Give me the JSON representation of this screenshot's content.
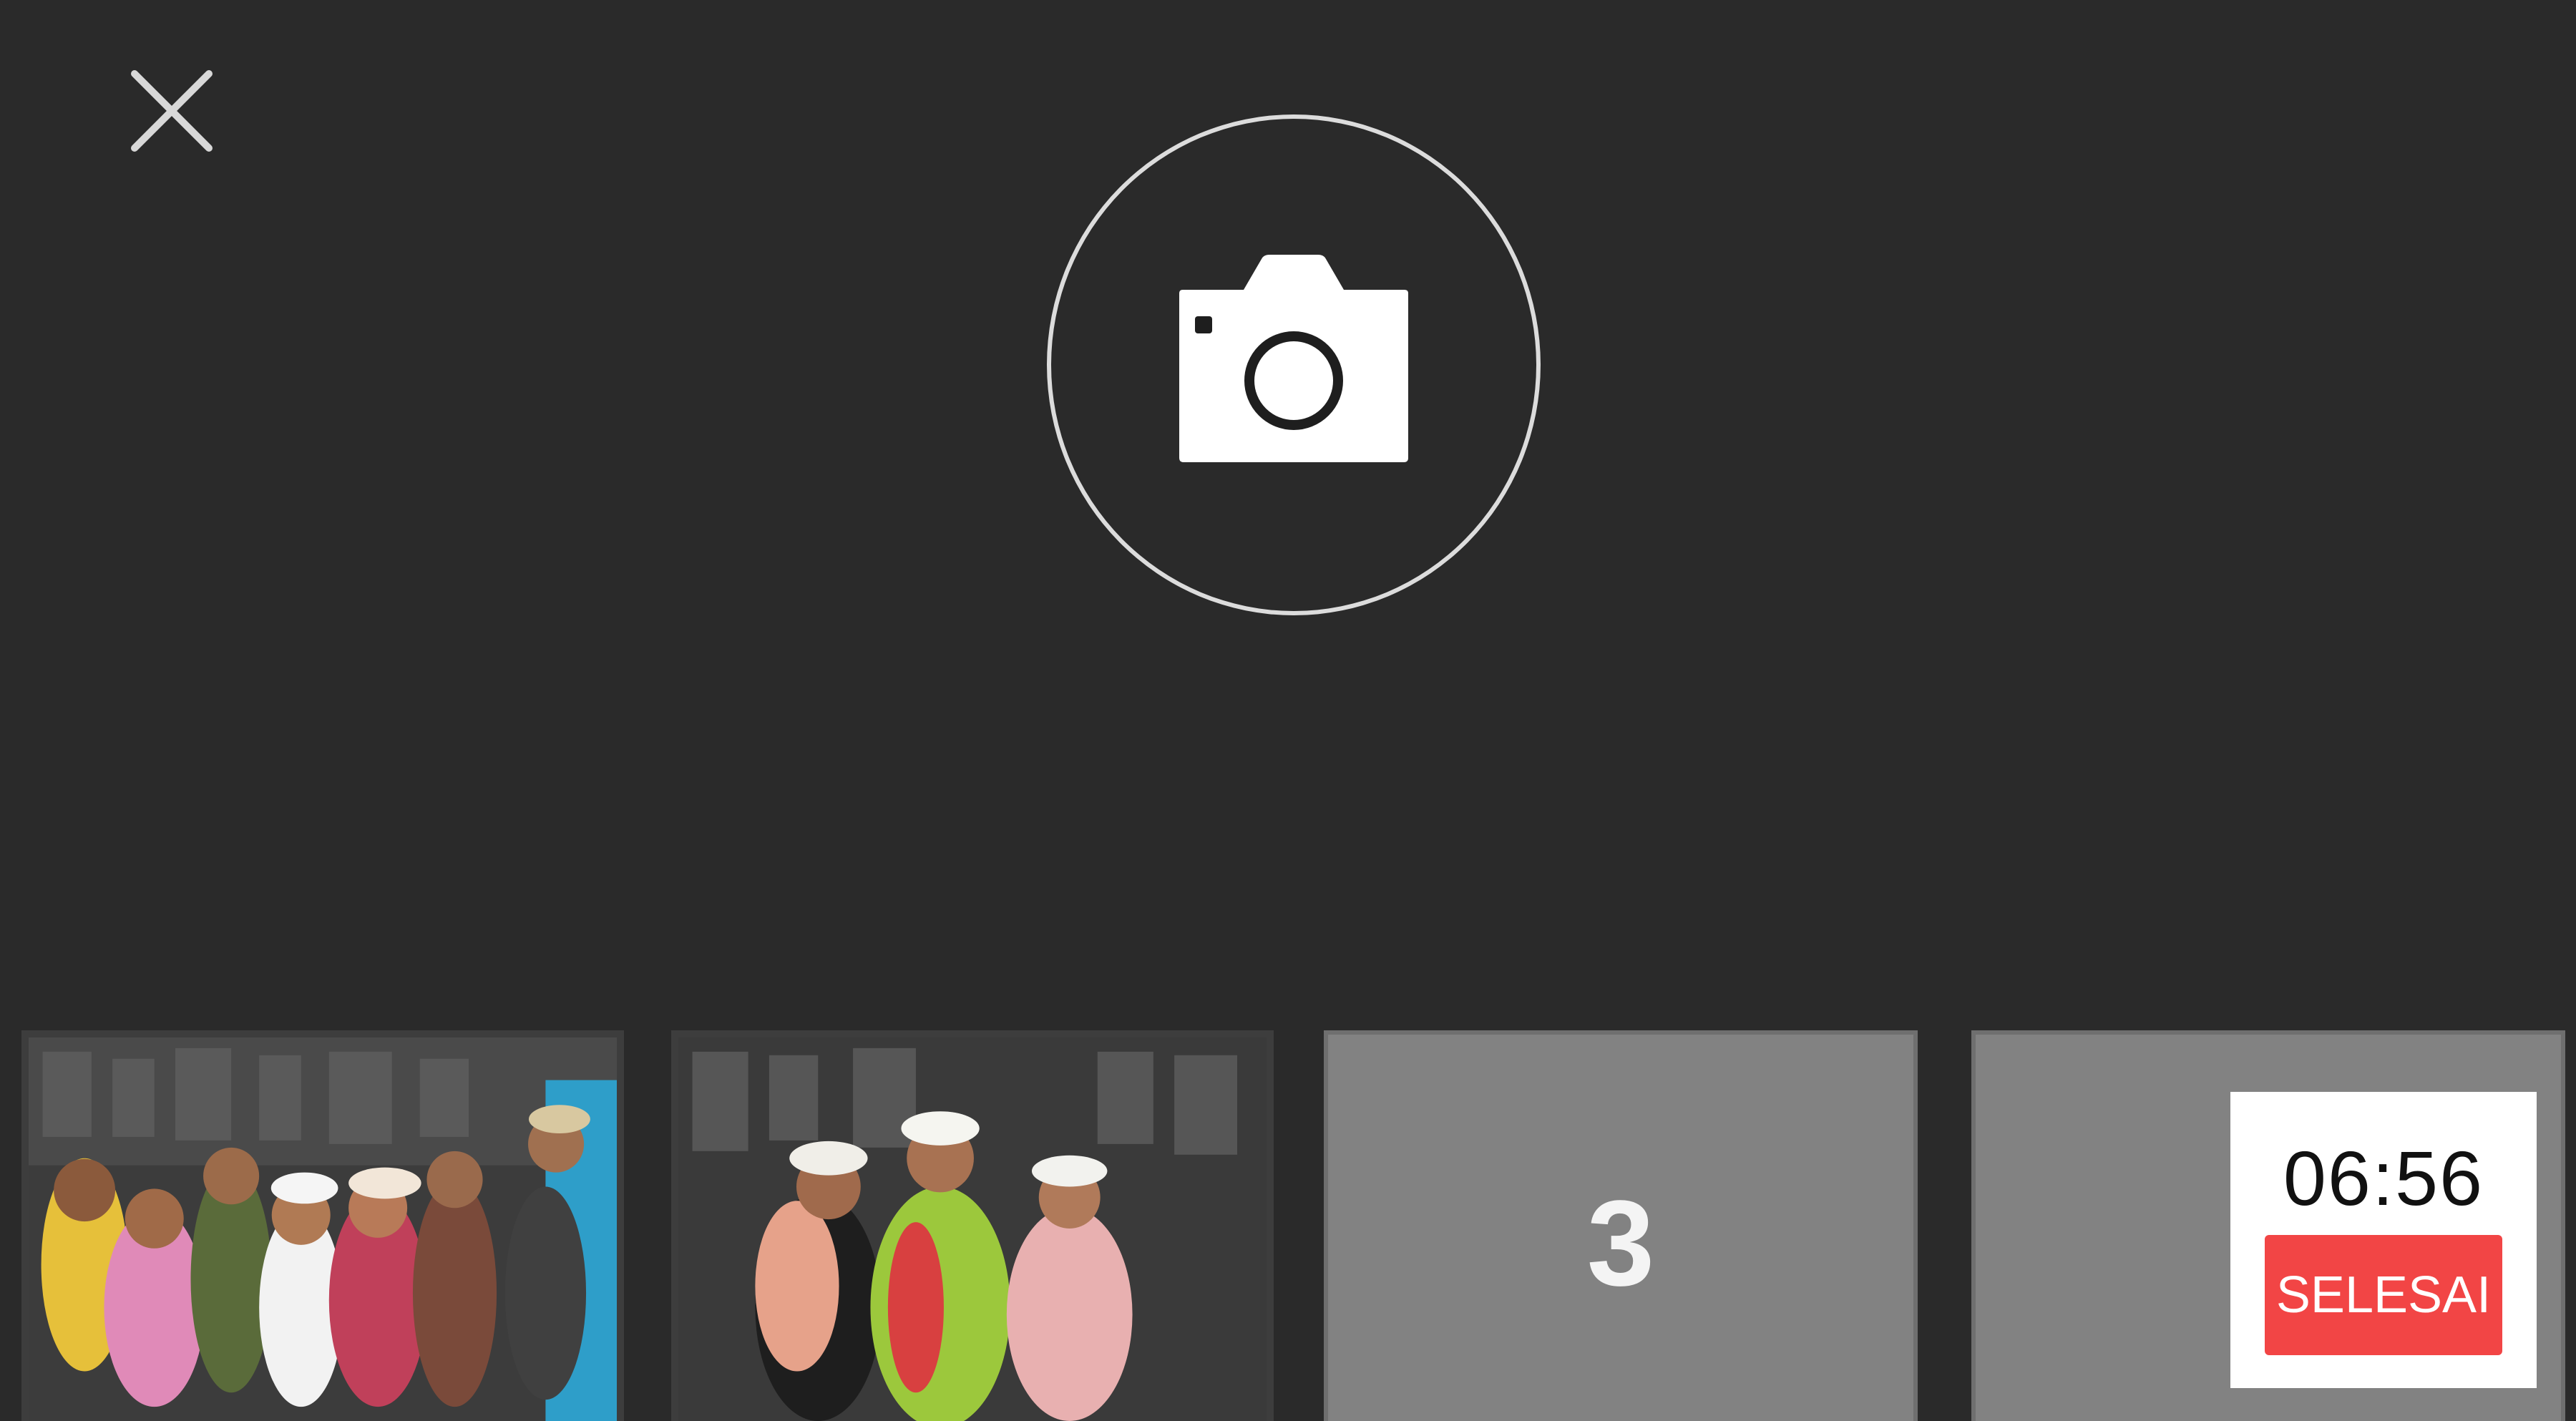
{
  "controls": {
    "close_icon": "close-icon",
    "shutter_icon": "camera-icon"
  },
  "strip": {
    "slots": [
      {
        "type": "photo"
      },
      {
        "type": "photo"
      },
      {
        "type": "empty",
        "number": "3"
      },
      {
        "type": "empty",
        "number": ""
      }
    ]
  },
  "timer": {
    "time": "06:56"
  },
  "done_button": {
    "label": "SELESAI"
  },
  "colors": {
    "background": "#2a2a2a",
    "accent": "#f24545",
    "slot_empty": "#828282"
  }
}
